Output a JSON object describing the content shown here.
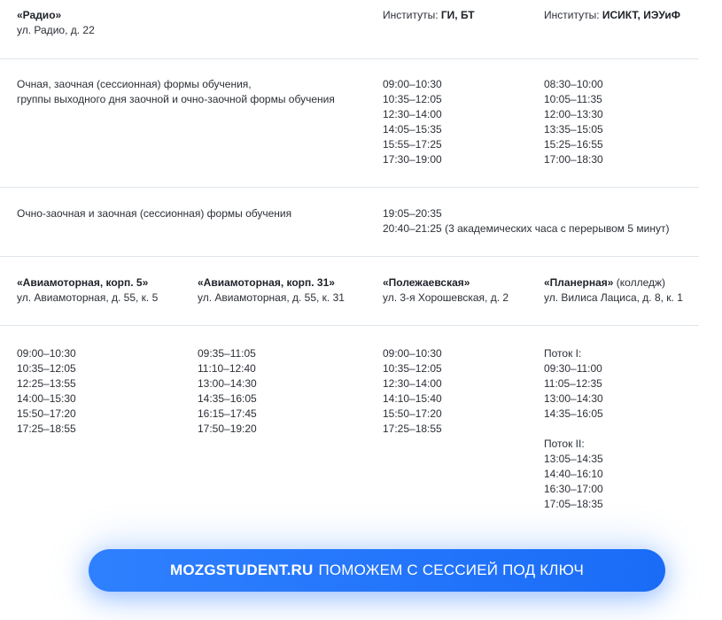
{
  "section1": {
    "campus_name": "«Радио»",
    "campus_address": "ул. Радио, д. 22",
    "institutes_a_prefix": "Институты: ",
    "institutes_a_names": "ГИ, БТ",
    "institutes_b_prefix": "Институты: ",
    "institutes_b_names": "ИСИКТ, ИЭУиФ"
  },
  "section2": {
    "line1": "Очная, заочная (сессионная) формы обучения,",
    "line2": "группы выходного дня заочной и очно-заочной формы обучения",
    "times_a": [
      "09:00–10:30",
      "10:35–12:05",
      "12:30–14:00",
      "14:05–15:35",
      "15:55–17:25",
      "17:30–19:00"
    ],
    "times_b": [
      "08:30–10:00",
      "10:05–11:35",
      "12:00–13:30",
      "13:35–15:05",
      "15:25–16:55",
      "17:00–18:30"
    ]
  },
  "section3": {
    "label": "Очно-заочная и заочная (сессионная) формы обучения",
    "time1": "19:05–20:35",
    "time2": "20:40–21:25 (3 академических часа с перерывом 5 минут)"
  },
  "section4": {
    "c1_name": "«Авиамоторная, корп. 5»",
    "c1_address": "ул. Авиамоторная, д. 55, к. 5",
    "c2_name": "«Авиамоторная, корп. 31»",
    "c2_address": "ул. Авиамоторная, д. 55, к. 31",
    "c3_name": "«Полежаевская»",
    "c3_address": "ул. 3-я Хорошевская, д. 2",
    "c4_name": "«Планерная»",
    "c4_suffix": " (колледж)",
    "c4_address": "ул. Вилиса Лациса, д. 8, к. 1"
  },
  "section5": {
    "c1_times": [
      "09:00–10:30",
      "10:35–12:05",
      "12:25–13:55",
      "14:00–15:30",
      "15:50–17:20",
      "17:25–18:55"
    ],
    "c2_times": [
      "09:35–11:05",
      "11:10–12:40",
      "13:00–14:30",
      "14:35–16:05",
      "16:15–17:45",
      "17:50–19:20"
    ],
    "c3_times": [
      "09:00–10:30",
      "10:35–12:05",
      "12:30–14:00",
      "14:10–15:40",
      "15:50–17:20",
      "17:25–18:55"
    ],
    "stream1_label": "Поток I:",
    "stream1_times": [
      "09:30–11:00",
      "11:05–12:35",
      "13:00–14:30",
      "14:35–16:05"
    ],
    "stream2_label": "Поток II:",
    "stream2_times": [
      "13:05–14:35",
      "14:40–16:10",
      "16:30–17:00",
      "17:05–18:35"
    ]
  },
  "cta": {
    "brand": "MOZGSTUDENT.RU",
    "text": "ПОМОЖЕМ С СЕССИЕЙ ПОД КЛЮЧ"
  }
}
